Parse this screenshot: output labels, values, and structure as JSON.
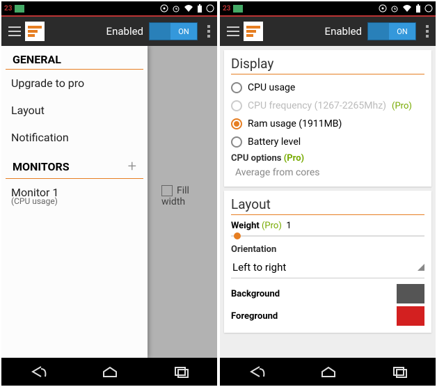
{
  "statusbar": {
    "num": "23"
  },
  "actionbar": {
    "label": "Enabled",
    "toggle": "ON"
  },
  "phone1": {
    "sections": {
      "general": "GENERAL",
      "monitors": "MONITORS"
    },
    "items": {
      "upgrade": "Upgrade to pro",
      "layout": "Layout",
      "notification": "Notification",
      "monitor1": "Monitor 1",
      "monitor1_sub": "(CPU usage)"
    },
    "behind": {
      "fill_width": "Fill width"
    }
  },
  "phone2": {
    "display": {
      "title": "Display",
      "cpu_usage": "CPU usage",
      "cpu_freq": "CPU frequency (1267-2265Mhz)",
      "ram": "Ram usage (1911MB)",
      "battery": "Battery level",
      "cpu_options": "CPU options",
      "avg": "Average from cores",
      "pro": "(Pro)"
    },
    "layout": {
      "title": "Layout",
      "weight": "Weight",
      "weight_val": "1",
      "orientation": "Orientation",
      "orientation_val": "Left to right",
      "background": "Background",
      "foreground": "Foreground",
      "bg_color": "#555555",
      "fg_color": "#d32020"
    }
  }
}
